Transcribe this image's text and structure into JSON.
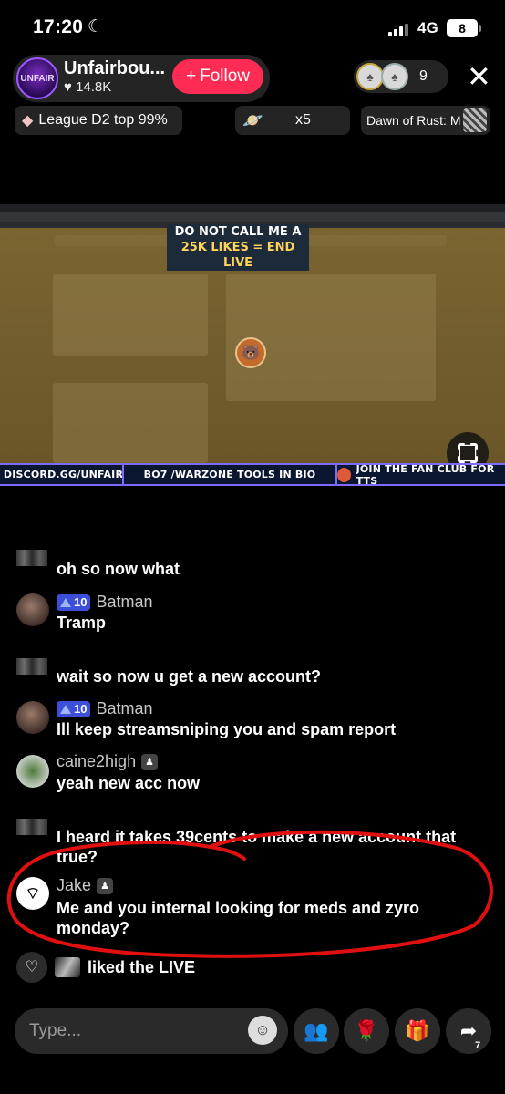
{
  "status_bar": {
    "time": "17:20",
    "network": "4G",
    "battery": "8"
  },
  "host": {
    "name": "Unfairbou...",
    "likes": "14.8K",
    "avatar_text": "UNFAIR",
    "follow_label": "Follow"
  },
  "viewers": {
    "count": "9"
  },
  "chips": {
    "league": "League D2 top 99%",
    "gift_count": "x5",
    "game": "Dawn of Rust: M"
  },
  "stream": {
    "overlay_line1": "DO NOT CALL ME A CHEATER",
    "overlay_line2": "25K LIKES = END LIVE",
    "banner_discord": "DISCORD.GG/UNFAIR",
    "banner_tools": "BO7 /WARZONE TOOLS IN BIO",
    "banner_fanclub": "JOIN THE FAN CLUB FOR TTS"
  },
  "chat": [
    {
      "name": "",
      "level": "",
      "text": "oh so now what"
    },
    {
      "name": "Batman",
      "level": "10",
      "text": "Tramp"
    },
    {
      "name": "",
      "level": "",
      "text": "wait so now u get a new account?"
    },
    {
      "name": "Batman",
      "level": "10",
      "text": "Ill keep streamsniping you and spam report"
    },
    {
      "name": "caine2high",
      "level": "",
      "text": "yeah new acc now"
    },
    {
      "name": "",
      "level": "",
      "text": "I heard it takes 39cents to make a new account that true?"
    },
    {
      "name": "Jake",
      "level": "",
      "text": "Me and you internal looking for meds and zyro monday?"
    }
  ],
  "liked": {
    "text": "liked the LIVE"
  },
  "bottom_bar": {
    "placeholder": "Type...",
    "share_count": "7"
  },
  "colors": {
    "follow": "#fe2c55",
    "scribble": "#e01010",
    "level_badge": "#3b4fd8"
  }
}
